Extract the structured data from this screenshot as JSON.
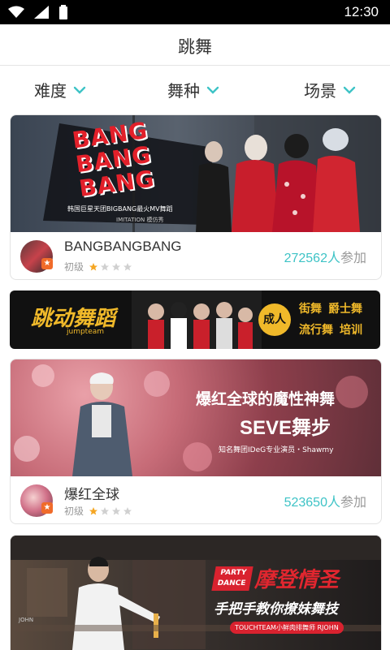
{
  "status": {
    "time": "12:30"
  },
  "header": {
    "title": "跳舞"
  },
  "filters": [
    {
      "label": "难度"
    },
    {
      "label": "舞种"
    },
    {
      "label": "场景"
    }
  ],
  "colors": {
    "accent": "#3ec3c6",
    "badge": "#f06b2a",
    "star_on": "#f5a623",
    "star_off": "#d0d0d0"
  },
  "cards": [
    {
      "banner": {
        "title_lines": [
          "BANG",
          "BANG",
          "BANG"
        ],
        "subtitle": "韩国巨星天团BIGBANG最火MV舞蹈",
        "caption": "IMITATION 模仿秀"
      },
      "name": "BANGBANGBANG",
      "level": "初级",
      "rating": 1,
      "count": "272562人",
      "count_suffix": "参加"
    },
    {
      "banner": {
        "title1": "爆红全球的魔性神舞",
        "title2": "SEVE舞步",
        "caption": "知名舞团IDeG专业演员・Shawmy"
      },
      "name": "爆红全球",
      "level": "初级",
      "rating": 1,
      "count": "523650人",
      "count_suffix": "参加"
    },
    {
      "banner": {
        "tag_line1": "PARTY",
        "tag_line2": "DANCE",
        "title1": "摩登情圣",
        "title2": "手把手教你撩妹舞技",
        "caption": "TOUCHTEAM小鲜肉排舞师 RJOHN",
        "sign": "JOHN"
      }
    }
  ],
  "ad": {
    "logo": "跳动舞蹈",
    "logo_en": "jumpteam",
    "circle": "成人",
    "tags": [
      "街舞",
      "爵士舞",
      "流行舞",
      "培训"
    ]
  }
}
